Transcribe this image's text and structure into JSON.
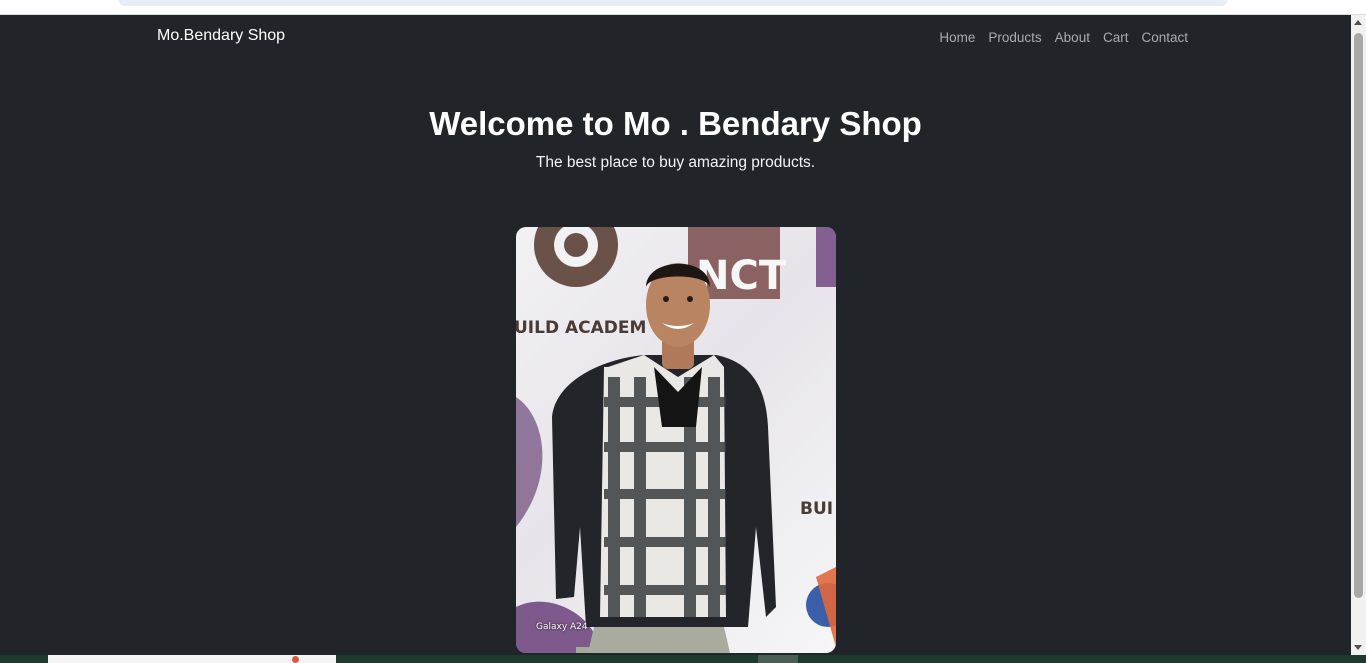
{
  "brand": "Mo.Bendary Shop",
  "nav": {
    "items": [
      "Home",
      "Products",
      "About",
      "Cart",
      "Contact"
    ]
  },
  "hero": {
    "title": "Welcome to Mo . Bendary Shop",
    "subtitle": "The best place to buy amazing products."
  },
  "photo": {
    "banner_text_1": "UILD ACADEM",
    "banner_text_2": "NCT",
    "banner_text_3": "BUI",
    "caption": "Galaxy A24"
  },
  "colors": {
    "page_background": "#212529",
    "nav_link": "#a7acb1",
    "text": "#ffffff"
  },
  "icons": [
    "scroll-up-arrow-icon",
    "scroll-down-arrow-icon"
  ]
}
